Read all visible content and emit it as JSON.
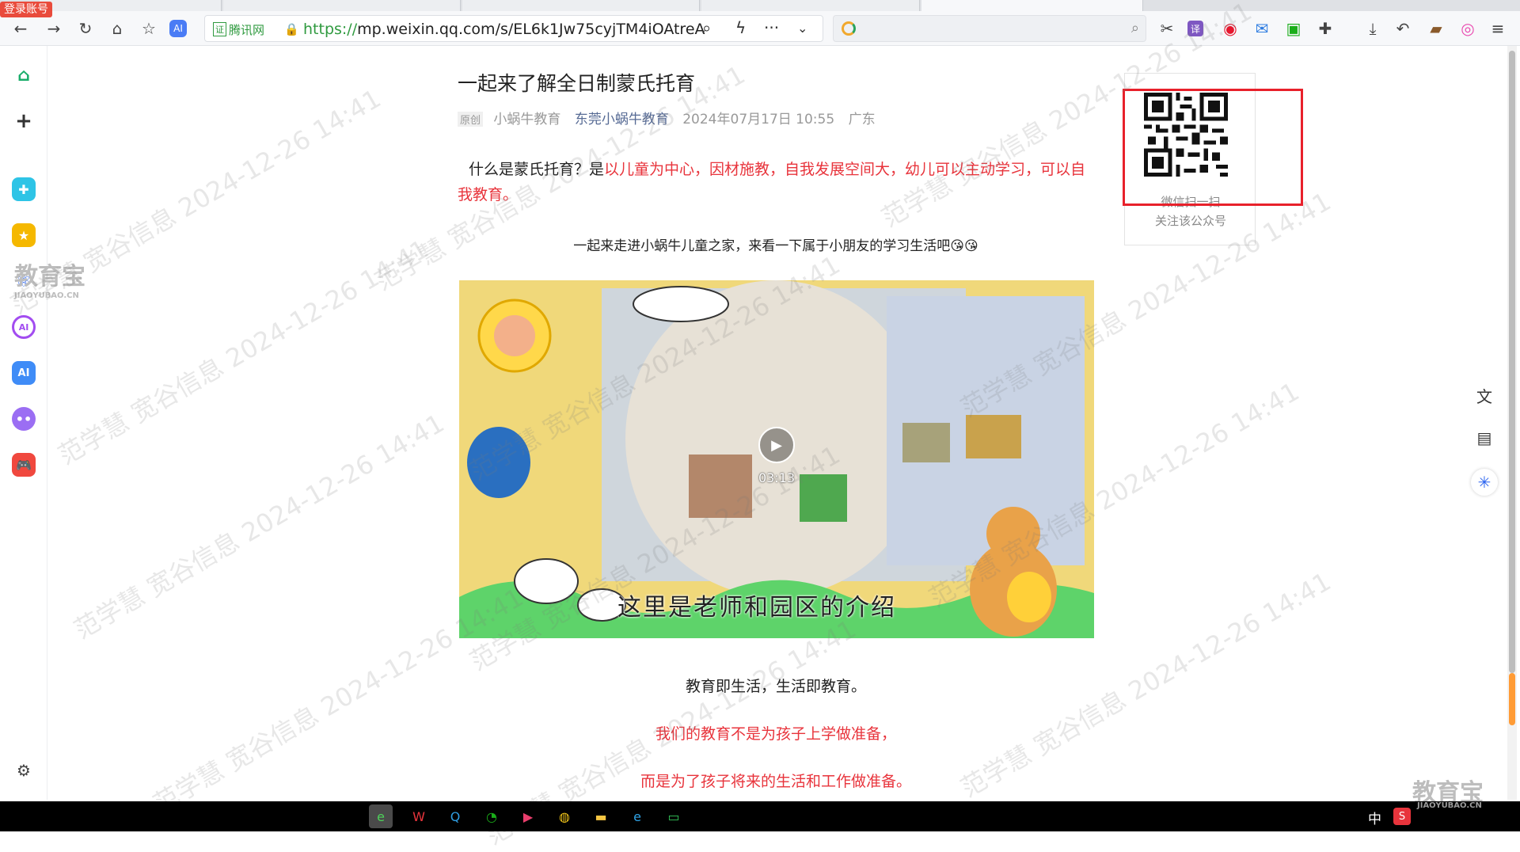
{
  "browser": {
    "login_badge": "登录账号",
    "address": {
      "cert_label": "腾讯网",
      "cert_badge": "证",
      "url_protocol": "https://",
      "url_rest": "mp.weixin.qq.com/s/EL6k1Jw75cyjTM4iOAtreA"
    },
    "toolbar_icons": [
      "back-icon",
      "forward-icon",
      "reload-icon",
      "home-icon",
      "favorites-icon",
      "ai-icon"
    ],
    "right_icons": [
      "cut-icon",
      "translate-icon",
      "weibo-icon",
      "mail-icon",
      "book-icon",
      "extension-icon",
      "download-icon",
      "undo-icon",
      "briefcase-icon",
      "browser-logo-icon",
      "menu-icon"
    ]
  },
  "sidebar": {
    "items": [
      "home-icon",
      "add-icon",
      "plus-app-icon",
      "star-icon",
      "molecule-icon",
      "ai-chat-icon",
      "ai-icon",
      "bot-icon",
      "game-icon"
    ],
    "settings": "gear-icon"
  },
  "article": {
    "title": "一起来了解全日制蒙氏托育",
    "meta": {
      "original": "原创",
      "author": "小蜗牛教育",
      "account": "东莞小蜗牛教育",
      "time": "2024年07月17日 10:55",
      "location": "广东"
    },
    "intro_black": "什么是蒙氏托育？是",
    "intro_red": "以儿童为中心，因材施教，自我发展空间大，幼儿可以主动学习，可以自我教育。",
    "line2": "一起来走进小蜗牛儿童之家，来看一下属于小朋友的学习生活吧😘😘",
    "video": {
      "duration": "03:13",
      "subtitle": "这里是老师和园区的介绍"
    },
    "line3": "教育即生活，生活即教育。",
    "line4": "我们的教育不是为孩子上学做准备，",
    "line5": "而是为了孩子将来的生活和工作做准备。"
  },
  "qr": {
    "caption1": "微信扫一扫",
    "caption2": "关注该公众号"
  },
  "watermark": {
    "text": "范学慧 宽谷信息 2024-12-26 14:41",
    "logo_cn": "教育宝",
    "logo_en": "JIAOYUBAO.CN"
  },
  "taskbar": {
    "ime": "中",
    "apps": [
      "ie-icon",
      "wps-icon",
      "search-app-icon",
      "wechat-icon",
      "media-icon",
      "chrome-icon",
      "folder-icon",
      "edge-icon",
      "terminal-icon"
    ]
  },
  "colors": {
    "accent_red": "#e8343c",
    "link_blue": "#576b95",
    "highlight_red": "#e8212b",
    "url_green": "#2f9a3f"
  }
}
